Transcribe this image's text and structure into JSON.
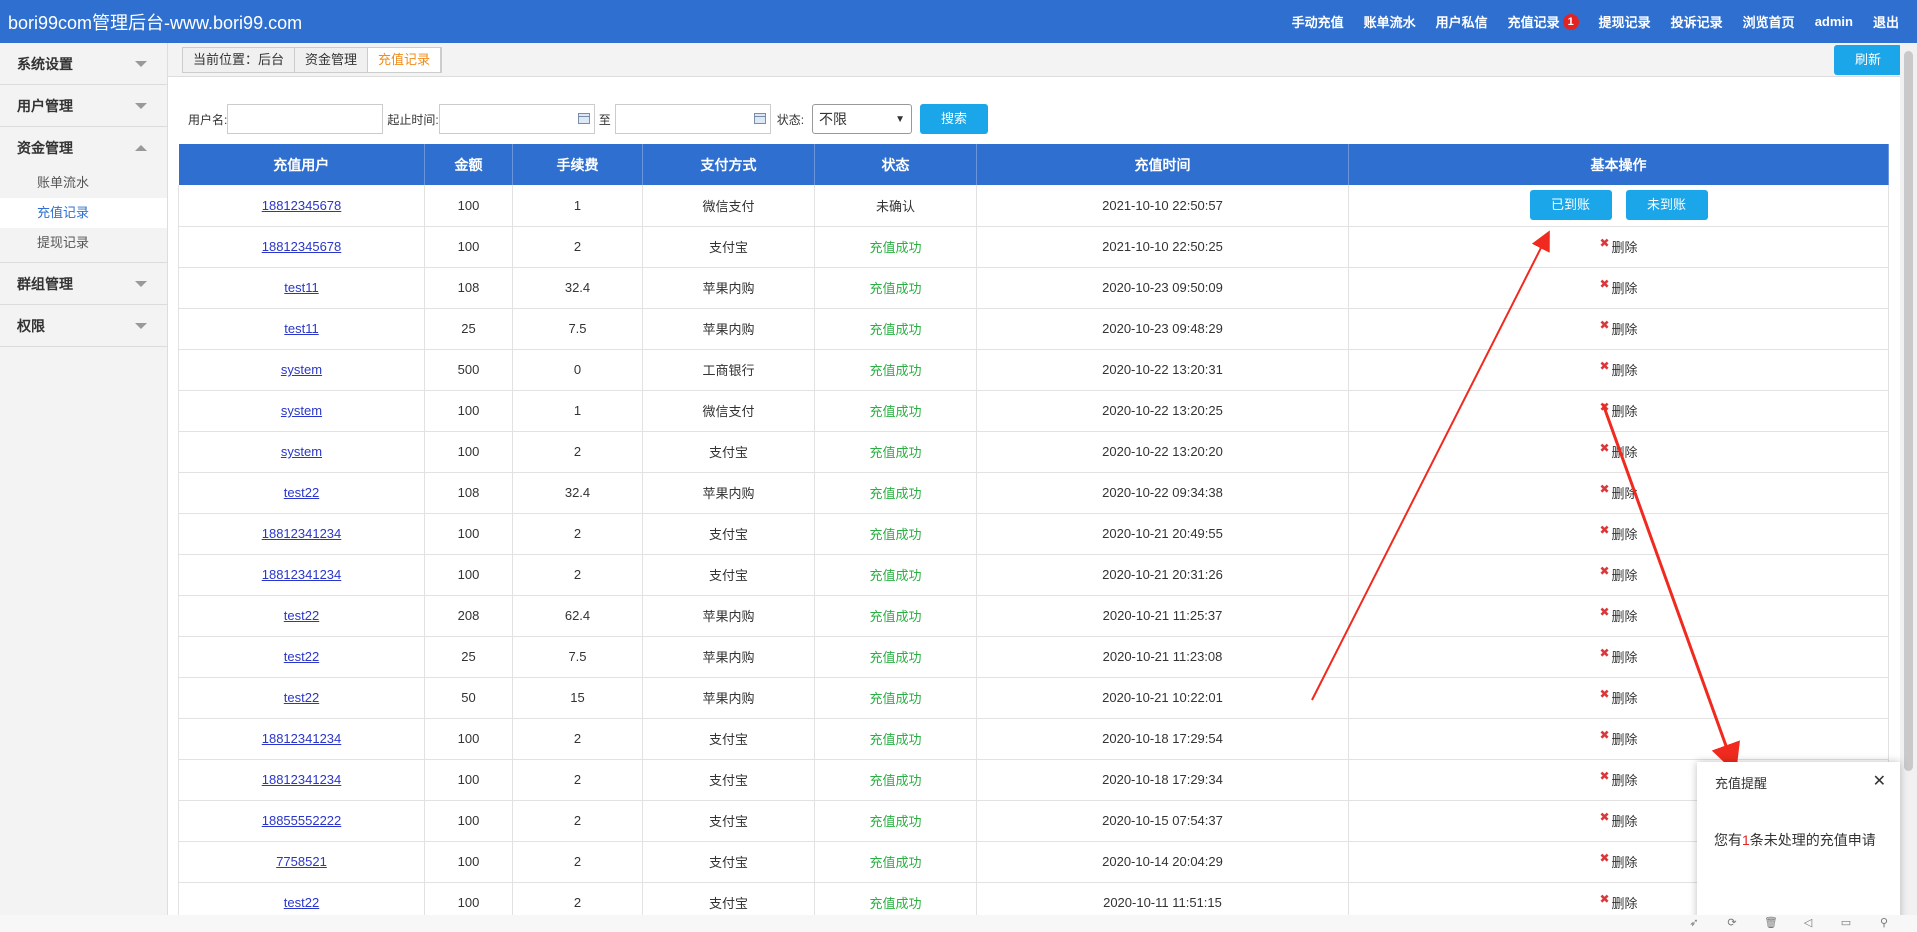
{
  "header": {
    "brand": "bori99com管理后台-www.bori99.com",
    "nav": [
      {
        "label": "手动充值"
      },
      {
        "label": "账单流水"
      },
      {
        "label": "用户私信"
      },
      {
        "label": "充值记录",
        "badge": "1"
      },
      {
        "label": "提现记录"
      },
      {
        "label": "投诉记录"
      },
      {
        "label": "浏览首页"
      },
      {
        "label": "admin"
      },
      {
        "label": "退出"
      }
    ]
  },
  "sidebar": {
    "groups": [
      {
        "label": "系统设置",
        "expanded": false,
        "items": []
      },
      {
        "label": "用户管理",
        "expanded": false,
        "items": []
      },
      {
        "label": "资金管理",
        "expanded": true,
        "items": [
          {
            "label": "账单流水",
            "active": false
          },
          {
            "label": "充值记录",
            "active": true
          },
          {
            "label": "提现记录",
            "active": false
          }
        ]
      },
      {
        "label": "群组管理",
        "expanded": false,
        "items": []
      },
      {
        "label": "权限",
        "expanded": false,
        "items": []
      }
    ]
  },
  "breadcrumb": [
    "当前位置：后台",
    "资金管理",
    "充值记录"
  ],
  "refresh_label": "刷新",
  "filter": {
    "username_label": "用户名:",
    "time_label": "起止时间:",
    "to_label": "至",
    "status_label": "状态:",
    "status_value": "不限",
    "search_label": "搜索"
  },
  "table": {
    "columns": [
      "充值用户",
      "金额",
      "手续费",
      "支付方式",
      "状态",
      "充值时间",
      "基本操作"
    ],
    "confirm_label": "已到账",
    "reject_label": "未到账",
    "delete_label": "删除",
    "rows": [
      {
        "user": "18812345678",
        "amount": "100",
        "fee": "1",
        "method": "微信支付",
        "status": "未确认",
        "time": "2021-10-10 22:50:57",
        "pending": true
      },
      {
        "user": "18812345678",
        "amount": "100",
        "fee": "2",
        "method": "支付宝",
        "status": "充值成功",
        "time": "2021-10-10 22:50:25"
      },
      {
        "user": "test11",
        "amount": "108",
        "fee": "32.4",
        "method": "苹果内购",
        "status": "充值成功",
        "time": "2020-10-23 09:50:09"
      },
      {
        "user": "test11",
        "amount": "25",
        "fee": "7.5",
        "method": "苹果内购",
        "status": "充值成功",
        "time": "2020-10-23 09:48:29"
      },
      {
        "user": "system",
        "amount": "500",
        "fee": "0",
        "method": "工商银行",
        "status": "充值成功",
        "time": "2020-10-22 13:20:31"
      },
      {
        "user": "system",
        "amount": "100",
        "fee": "1",
        "method": "微信支付",
        "status": "充值成功",
        "time": "2020-10-22 13:20:25"
      },
      {
        "user": "system",
        "amount": "100",
        "fee": "2",
        "method": "支付宝",
        "status": "充值成功",
        "time": "2020-10-22 13:20:20"
      },
      {
        "user": "test22",
        "amount": "108",
        "fee": "32.4",
        "method": "苹果内购",
        "status": "充值成功",
        "time": "2020-10-22 09:34:38"
      },
      {
        "user": "18812341234",
        "amount": "100",
        "fee": "2",
        "method": "支付宝",
        "status": "充值成功",
        "time": "2020-10-21 20:49:55"
      },
      {
        "user": "18812341234",
        "amount": "100",
        "fee": "2",
        "method": "支付宝",
        "status": "充值成功",
        "time": "2020-10-21 20:31:26"
      },
      {
        "user": "test22",
        "amount": "208",
        "fee": "62.4",
        "method": "苹果内购",
        "status": "充值成功",
        "time": "2020-10-21 11:25:37"
      },
      {
        "user": "test22",
        "amount": "25",
        "fee": "7.5",
        "method": "苹果内购",
        "status": "充值成功",
        "time": "2020-10-21 11:23:08"
      },
      {
        "user": "test22",
        "amount": "50",
        "fee": "15",
        "method": "苹果内购",
        "status": "充值成功",
        "time": "2020-10-21 10:22:01"
      },
      {
        "user": "18812341234",
        "amount": "100",
        "fee": "2",
        "method": "支付宝",
        "status": "充值成功",
        "time": "2020-10-18 17:29:54"
      },
      {
        "user": "18812341234",
        "amount": "100",
        "fee": "2",
        "method": "支付宝",
        "status": "充值成功",
        "time": "2020-10-18 17:29:34"
      },
      {
        "user": "18855552222",
        "amount": "100",
        "fee": "2",
        "method": "支付宝",
        "status": "充值成功",
        "time": "2020-10-15 07:54:37"
      },
      {
        "user": "7758521",
        "amount": "100",
        "fee": "2",
        "method": "支付宝",
        "status": "充值成功",
        "time": "2020-10-14 20:04:29"
      },
      {
        "user": "test22",
        "amount": "100",
        "fee": "2",
        "method": "支付宝",
        "status": "充值成功",
        "time": "2020-10-11 11:51:15"
      }
    ]
  },
  "popup": {
    "title": "充值提醒",
    "close": "✕",
    "text_before": "您有",
    "count": "1",
    "text_after": "条未处理的充值申请"
  },
  "colors": {
    "primary": "#2f6fd0",
    "button": "#1aa6e8",
    "success": "#2ab042",
    "danger": "#e52222",
    "arrow": "#f02a1e"
  },
  "taskbar_icons": [
    "rocket-icon",
    "refresh-icon",
    "trash-icon",
    "speaker-icon",
    "window-icon",
    "search-icon"
  ]
}
